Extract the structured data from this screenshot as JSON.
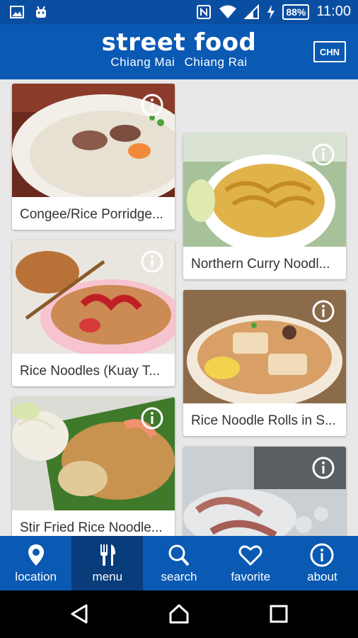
{
  "status": {
    "battery": "88%",
    "time": "11:00"
  },
  "header": {
    "title": "street food",
    "sub_left": "Chiang Mai",
    "sub_right": "Chiang Rai",
    "lang_button": "CHN"
  },
  "cards": [
    {
      "label": "Congee/Rice Porridge...",
      "column": "left"
    },
    {
      "label": "Northern Curry Noodl...",
      "column": "right"
    },
    {
      "label": "Rice Noodles (Kuay T...",
      "column": "left"
    },
    {
      "label": "Rice Noodle Rolls in S...",
      "column": "right"
    },
    {
      "label": "Stir Fried Rice Noodle...",
      "column": "left"
    },
    {
      "label": "",
      "column": "right"
    }
  ],
  "nav": [
    {
      "label": "location",
      "icon": "location-pin-icon"
    },
    {
      "label": "menu",
      "icon": "fork-knife-icon",
      "active": true
    },
    {
      "label": "search",
      "icon": "search-icon"
    },
    {
      "label": "favorite",
      "icon": "heart-icon"
    },
    {
      "label": "about",
      "icon": "info-icon"
    }
  ],
  "colors": {
    "primary": "#0a59b3",
    "status_bar": "#0a4ea2",
    "active_nav": "#083c7a"
  }
}
